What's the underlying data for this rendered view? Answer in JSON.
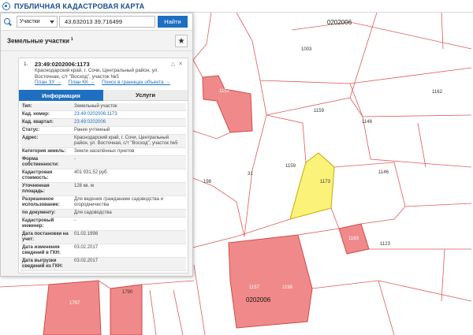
{
  "header": {
    "title": "ПУБЛИЧНАЯ КАДАСТРОВАЯ КАРТА"
  },
  "search": {
    "type_value": "Участки",
    "query": "43,632013 39,716499",
    "find_label": "Найти"
  },
  "results": {
    "section_title": "Земельные участки",
    "count": "1",
    "card": {
      "index": "1.",
      "kad_number": "23:49:0202006:1173",
      "address": "Краснодарский край, г. Сочи, Центральный район, ул. Восточная, с/т \"Восход\", участок №5",
      "links": [
        "План ЗУ →",
        "План КК →",
        "Поиск в границах объекта →"
      ],
      "tabs": [
        "Информация",
        "Услуги"
      ]
    },
    "info_rows": [
      {
        "k": "Тип:",
        "v": "Земельный участок"
      },
      {
        "k": "Кад. номер:",
        "v": "23:49:0202006:1173"
      },
      {
        "k": "Кад. квартал:",
        "v": "23:49:0202006"
      },
      {
        "k": "Статус:",
        "v": "Ранее учтенный"
      },
      {
        "k": "Адрес:",
        "v": "Краснодарский край, г. Сочи, Центральный район, ул. Восточная, с/т \"Восход\", участок №5"
      },
      {
        "k": "Категория земель:",
        "v": "Земли населённых пунктов"
      },
      {
        "k": "Форма собственности:",
        "v": "-"
      },
      {
        "k": "Кадастровая стоимость:",
        "v": "401 931,52 руб."
      },
      {
        "k": "Уточненная площадь:",
        "v": "128 кв. м"
      },
      {
        "k": "Разрешенное использование:",
        "v": "Для ведения гражданами садоводства и огородничества"
      },
      {
        "k": "по документу:",
        "v": "Для садоводства"
      },
      {
        "k": "Кадастровый инженер:",
        "v": "-"
      },
      {
        "k": "Дата постановки на учет:",
        "v": "01.02.1998"
      },
      {
        "k": "Дата изменения сведений в ГКН:",
        "v": "03.02.2017"
      },
      {
        "k": "Дата выгрузки сведений из ГКН:",
        "v": "03.02.2017"
      }
    ]
  },
  "map": {
    "labels": {
      "quarter_top": "0202006",
      "quarter_bottom": "0202006",
      "l1003": "1003",
      "l1152": "1152",
      "l1162": "1162",
      "l1159a": "1159",
      "l1146a": "1146",
      "l1159b": "1159",
      "l1173": "1173",
      "l1146b": "1146",
      "l31": "31",
      "l1163": "1163",
      "l1123": "1123",
      "l1157": "1157",
      "l1158": "1158",
      "l1790": "1790",
      "l1797": "1797",
      "l1198": "198"
    },
    "colors": {
      "parcel_red": "#f08a8a",
      "parcel_red_border": "#d24a4a",
      "selected_yellow": "#fbf27a",
      "line_red": "#e05a5a"
    }
  }
}
